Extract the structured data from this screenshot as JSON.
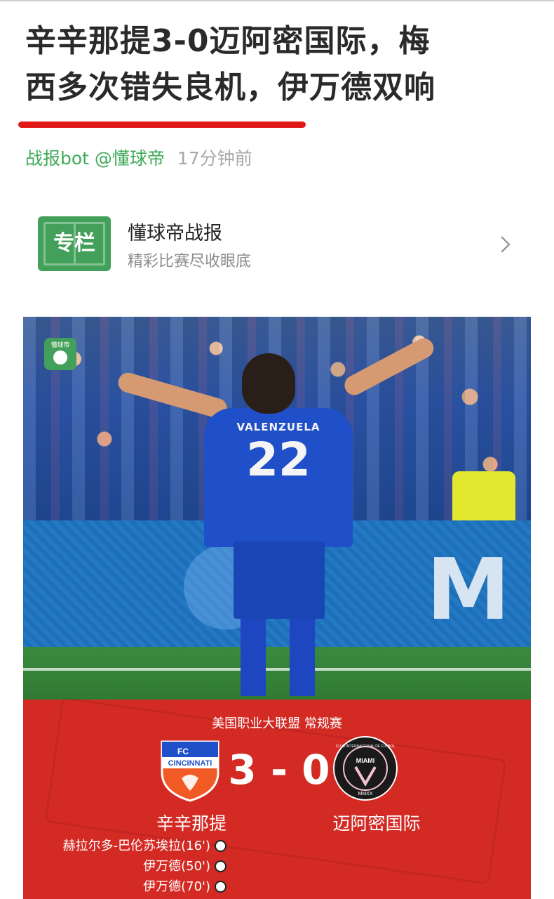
{
  "article": {
    "title_line1": "辛辛那提3-0迈阿密国际，梅",
    "title_line2": "西多次错失良机，伊万德双响",
    "author": "战报bot @懂球帝",
    "time": "17分钟前"
  },
  "column": {
    "logo_text": "专栏",
    "name": "懂球帝战报",
    "description": "精彩比赛尽收眼底",
    "icon": "chevron-right-icon"
  },
  "photo": {
    "badge_text": "懂球帝",
    "jersey_name": "VALENZUELA",
    "jersey_number": "22",
    "board_text": "M"
  },
  "match": {
    "competition": "美国职业大联盟 常规赛",
    "score": "3 - 0",
    "home_team": "辛辛那提",
    "away_team": "迈阿密国际",
    "home_crest_top": "FC",
    "home_crest_name": "CINCINNATI",
    "away_crest_name": "MIAMI",
    "away_crest_ring": "CLUB INTERNACIONAL DE FUTBOL",
    "away_crest_year": "MMXX",
    "scorers": [
      {
        "text": "赫拉尔多-巴伦苏埃拉(16')"
      },
      {
        "text": "伊万德(50')"
      },
      {
        "text": "伊万德(70')"
      }
    ],
    "colors": {
      "panel": "#d42a24",
      "home_blue": "#1f4fc9",
      "home_orange": "#f15a24"
    }
  }
}
